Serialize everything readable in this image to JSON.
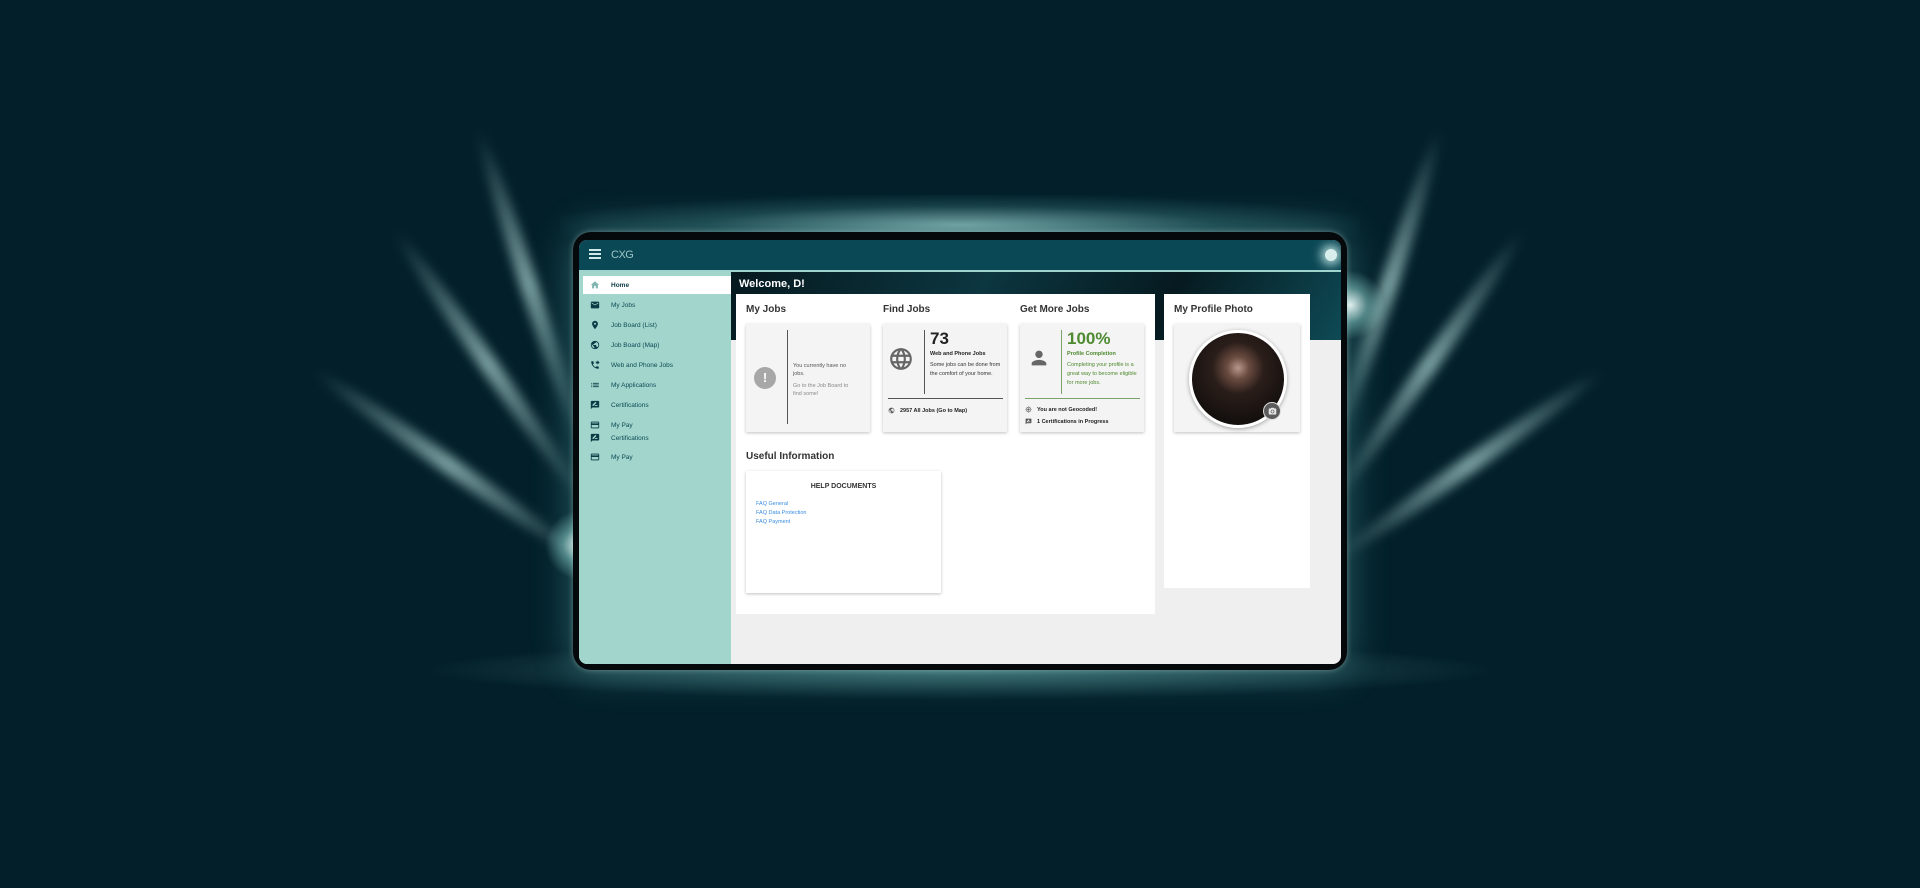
{
  "app": {
    "brand": "CXG"
  },
  "sidebar": {
    "items": [
      {
        "label": "Home",
        "icon": "home-icon",
        "active": true
      },
      {
        "label": "My Jobs",
        "icon": "mail-icon"
      },
      {
        "label": "Job Board (List)",
        "icon": "location-pin-icon"
      },
      {
        "label": "Job Board (Map)",
        "icon": "globe-icon"
      },
      {
        "label": "Web and Phone Jobs",
        "icon": "phone-forward-icon"
      },
      {
        "label": "My Applications",
        "icon": "list-icon"
      },
      {
        "label": "Certifications",
        "icon": "certificate-icon"
      },
      {
        "label": "My Pay",
        "icon": "credit-card-icon"
      },
      {
        "label": "Certifications",
        "icon": "certificate-icon"
      },
      {
        "label": "My Pay",
        "icon": "credit-card-icon"
      }
    ]
  },
  "hero": {
    "welcome": "Welcome, D!"
  },
  "my_jobs": {
    "title": "My Jobs",
    "empty_text": "You currently have no jobs.",
    "hint_text": "Go to the Job Board to find some!"
  },
  "find_jobs": {
    "title": "Find Jobs",
    "count": "73",
    "subtitle": "Web and Phone Jobs",
    "description": "Some jobs can be done from the comfort of your home.",
    "all_jobs_link": "2957 All Jobs (Go to Map)"
  },
  "get_more_jobs": {
    "title": "Get More Jobs",
    "percent": "100%",
    "subtitle": "Profile Completion",
    "description": "Completing your profile is a great way to become eligible for more jobs.",
    "geocoded_text": "You are not Geocoded!",
    "certifications_text": "1 Certifications in Progress"
  },
  "useful_info": {
    "title": "Useful Information",
    "help_title": "HELP DOCUMENTS",
    "links": [
      "FAQ General",
      "FAQ Data Protection",
      "FAQ Payment"
    ]
  },
  "profile_photo": {
    "title": "My Profile Photo"
  },
  "colors": {
    "topbar": "#0b4855",
    "sidebar": "#a2d5cc",
    "accent_green": "#4e8a2f",
    "link_blue": "#3a8de0"
  }
}
